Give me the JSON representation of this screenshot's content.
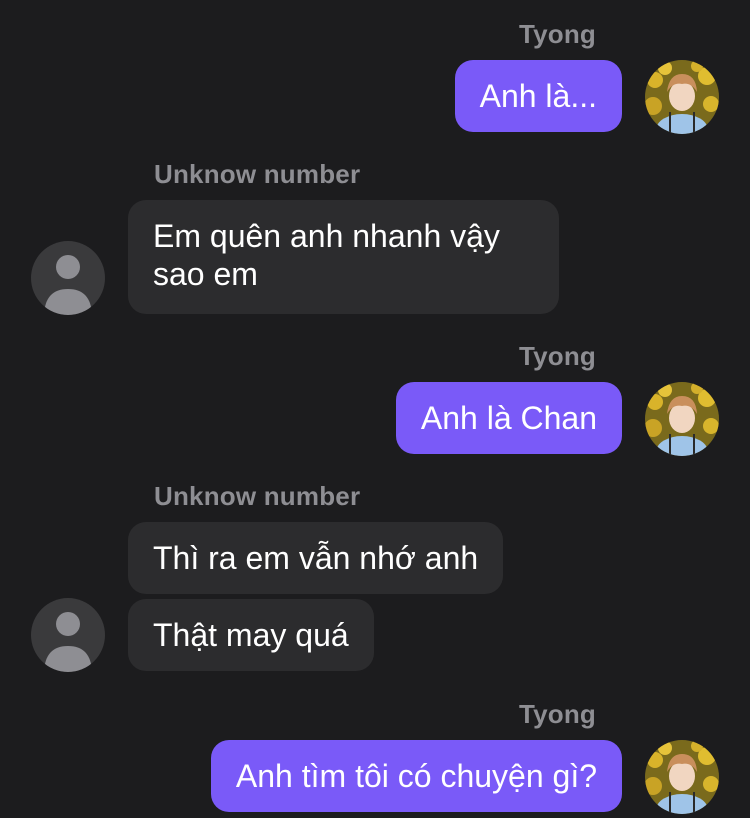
{
  "messages": [
    {
      "sender": "Tyong",
      "text": "Anh là..."
    },
    {
      "sender": "Unknow number",
      "text": "Em quên anh nhanh vậy sao em"
    },
    {
      "sender": "Tyong",
      "text": "Anh là Chan"
    },
    {
      "sender": "Unknow number",
      "text": "Thì ra em vẫn nhớ anh"
    },
    {
      "sender": "Unknow number",
      "text": "Thật may quá"
    },
    {
      "sender": "Tyong",
      "text": "Anh tìm tôi có chuyện gì?"
    }
  ],
  "colors": {
    "background": "#1c1c1e",
    "outgoing_bubble": "#7a5af8",
    "incoming_bubble": "#2c2c2e",
    "sender_name": "#8e8e93"
  },
  "icons": {
    "user_avatar": "profile-photo",
    "unknown_avatar": "person-silhouette-icon"
  }
}
